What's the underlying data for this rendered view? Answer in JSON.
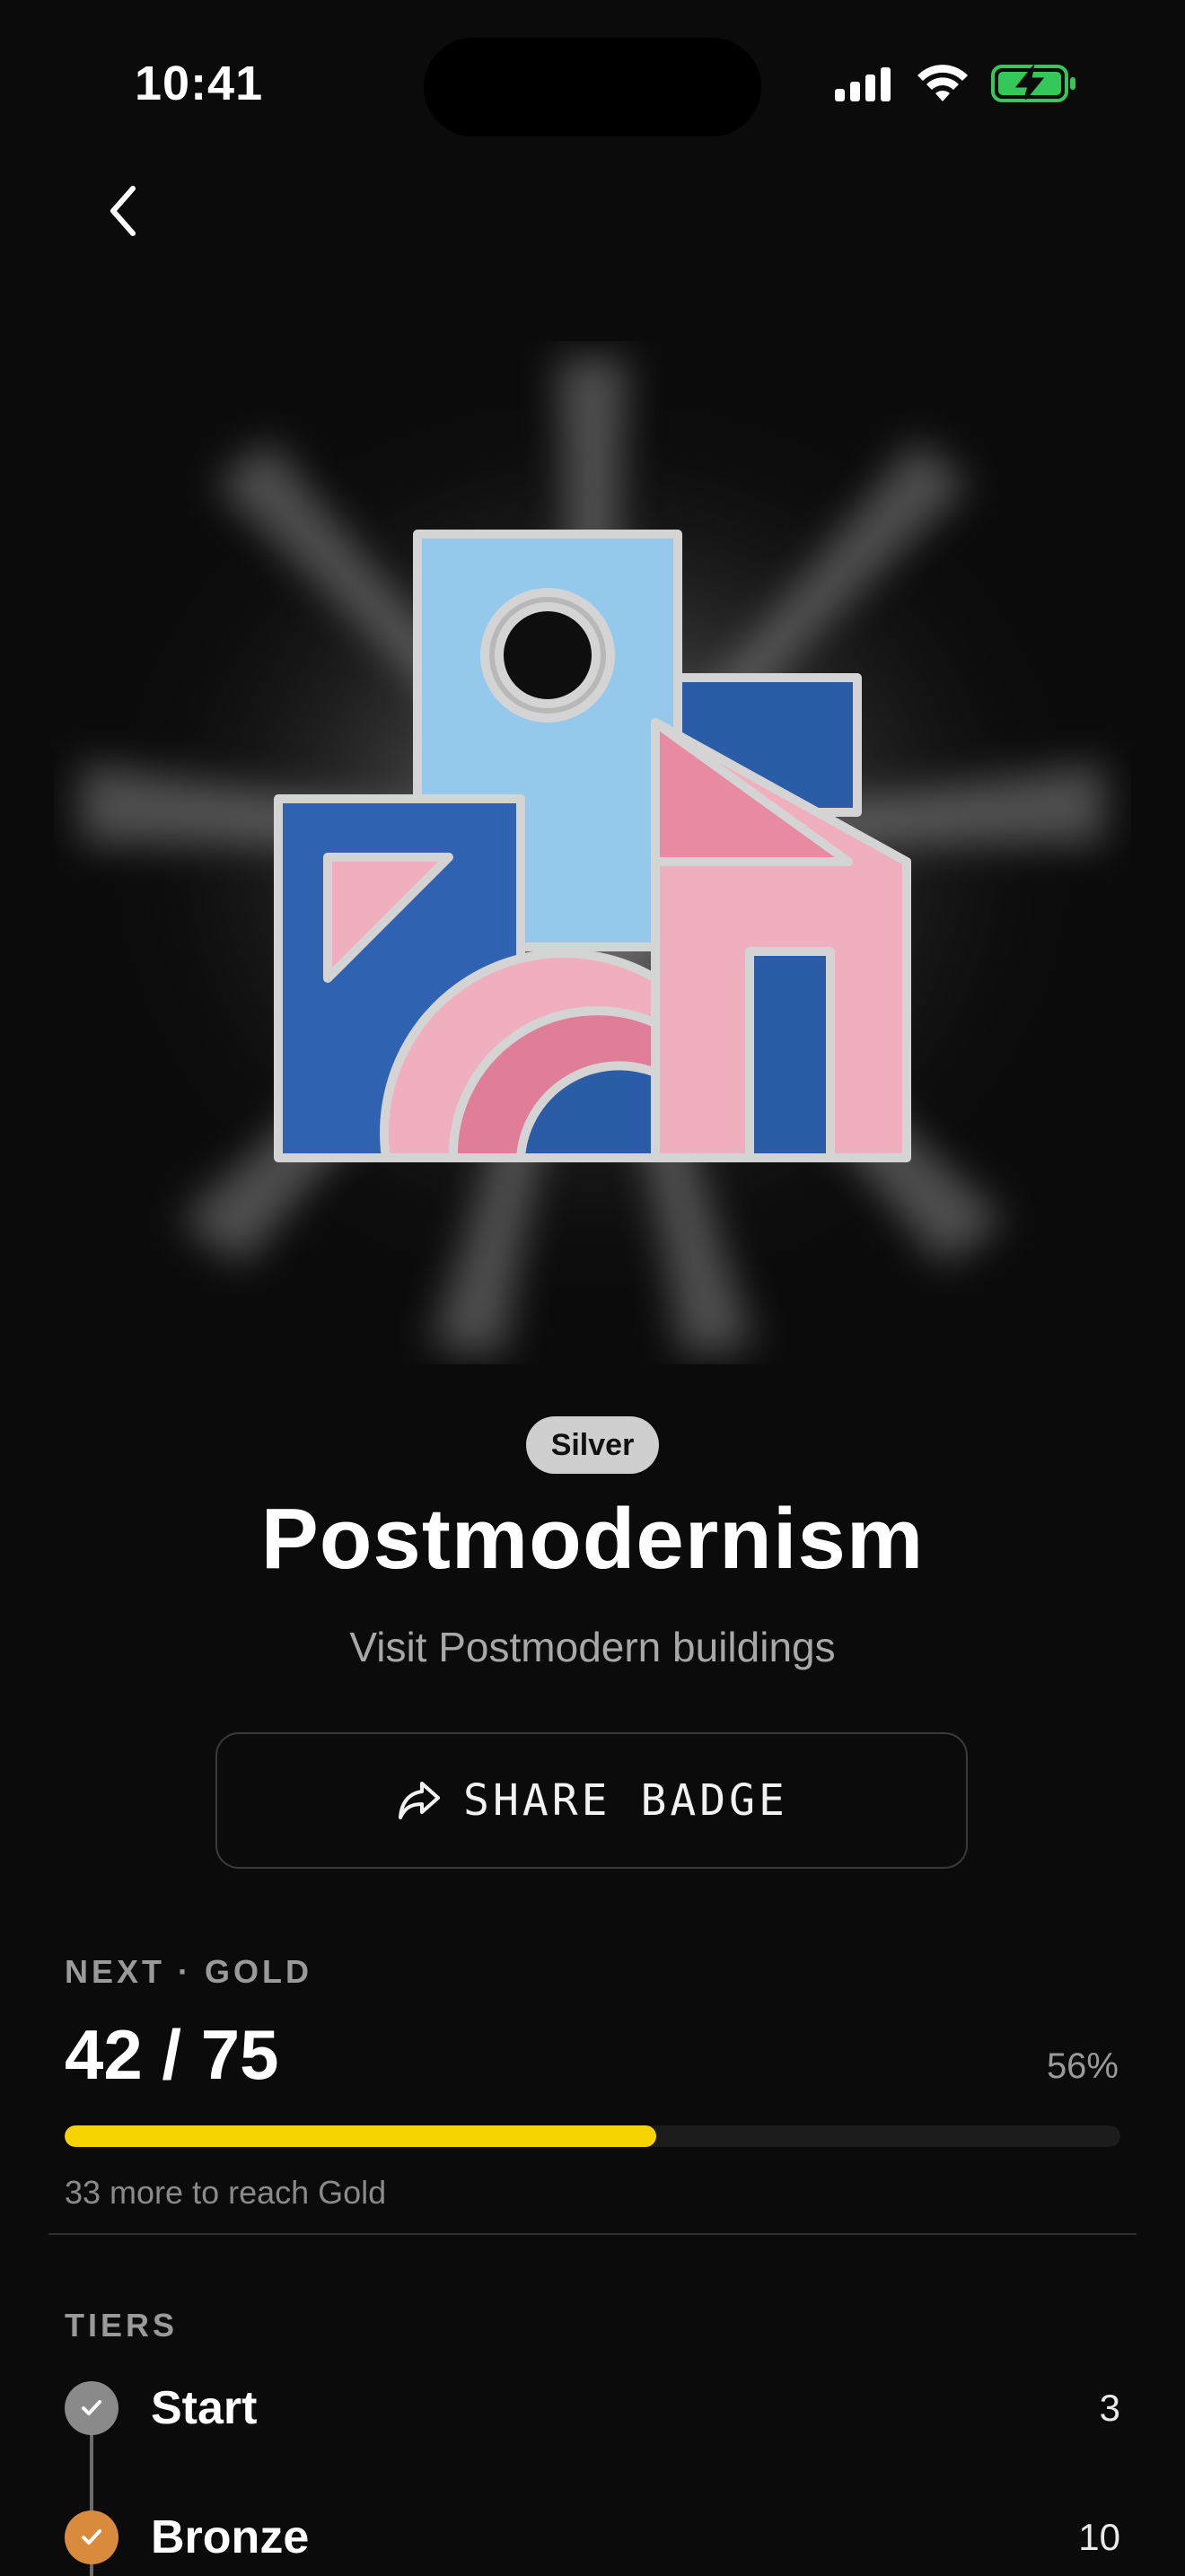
{
  "status_bar": {
    "time": "10:41"
  },
  "nav": {
    "back_icon": "chevron-left-icon"
  },
  "badge": {
    "tier": "Silver",
    "title": "Postmodernism",
    "subtitle": "Visit Postmodern buildings",
    "colors": {
      "light_blue": "#94c9ec",
      "dark_blue": "#2a5ca8",
      "pink": "#f0afbe",
      "rose": "#e07d98",
      "silver": "#d9d9d9"
    }
  },
  "share": {
    "label": "SHARE BADGE",
    "icon": "share-icon"
  },
  "progress": {
    "next_label": "NEXT · GOLD",
    "value_text": "42 / 75",
    "percent_text": "56%",
    "fraction": 0.56,
    "remaining_text": "33 more to reach Gold",
    "bar_color": "#f7d400"
  },
  "tiers": {
    "label": "TIERS",
    "items": [
      {
        "name": "Start",
        "value": "3",
        "color": "#8a8a8a"
      },
      {
        "name": "Bronze",
        "value": "10",
        "color": "#d98a3c"
      }
    ]
  }
}
